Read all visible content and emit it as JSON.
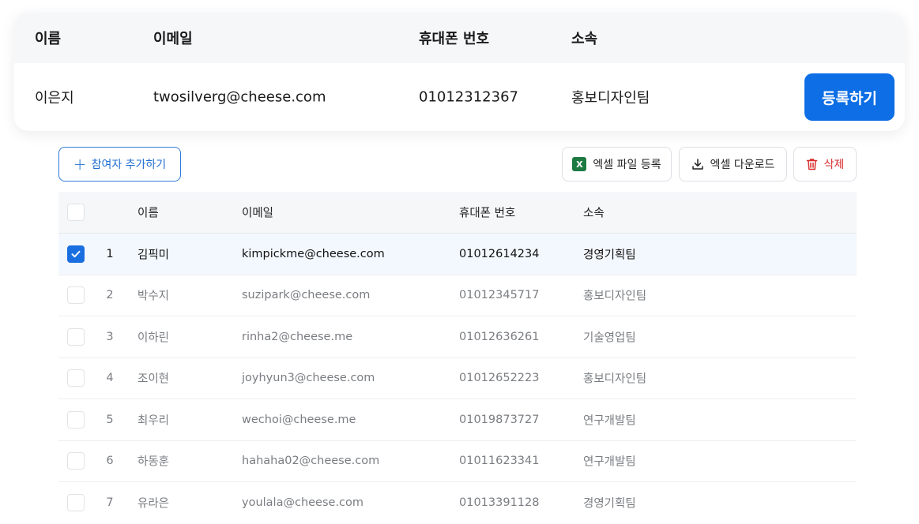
{
  "registration": {
    "headers": {
      "name": "이름",
      "email": "이메일",
      "phone": "휴대폰 번호",
      "org": "소속"
    },
    "row": {
      "name": "이은지",
      "email": "twosilverg@cheese.com",
      "phone": "01012312367",
      "org": "홍보디자인팀"
    },
    "submit_label": "등록하기"
  },
  "toolbar": {
    "add_label": "참여자 추가하기",
    "upload_label": "엑셀 파일 등록",
    "download_label": "엑셀 다운로드",
    "delete_label": "삭제"
  },
  "table": {
    "headers": {
      "name": "이름",
      "email": "이메일",
      "phone": "휴대폰 번호",
      "org": "소속"
    },
    "rows": [
      {
        "num": "1",
        "name": "김픽미",
        "email": "kimpickme@cheese.com",
        "phone": "01012614234",
        "org": "경영기획팀",
        "checked": true
      },
      {
        "num": "2",
        "name": "박수지",
        "email": "suzipark@cheese.com",
        "phone": "01012345717",
        "org": "홍보디자인팀",
        "checked": false
      },
      {
        "num": "3",
        "name": "이하린",
        "email": "rinha2@cheese.me",
        "phone": "01012636261",
        "org": "기술영업팀",
        "checked": false
      },
      {
        "num": "4",
        "name": "조이현",
        "email": "joyhyun3@cheese.com",
        "phone": "01012652223",
        "org": "홍보디자인팀",
        "checked": false
      },
      {
        "num": "5",
        "name": "최우리",
        "email": "wechoi@cheese.me",
        "phone": "01019873727",
        "org": "연구개발팀",
        "checked": false
      },
      {
        "num": "6",
        "name": "하동훈",
        "email": "hahaha02@cheese.com",
        "phone": "01011623341",
        "org": "연구개발팀",
        "checked": false
      },
      {
        "num": "7",
        "name": "유라은",
        "email": "youlala@cheese.com",
        "phone": "01013391128",
        "org": "경영기획팀",
        "checked": false
      }
    ]
  },
  "colors": {
    "primary": "#0d6ee5",
    "danger": "#d72b2b",
    "excel": "#1e7a43"
  }
}
